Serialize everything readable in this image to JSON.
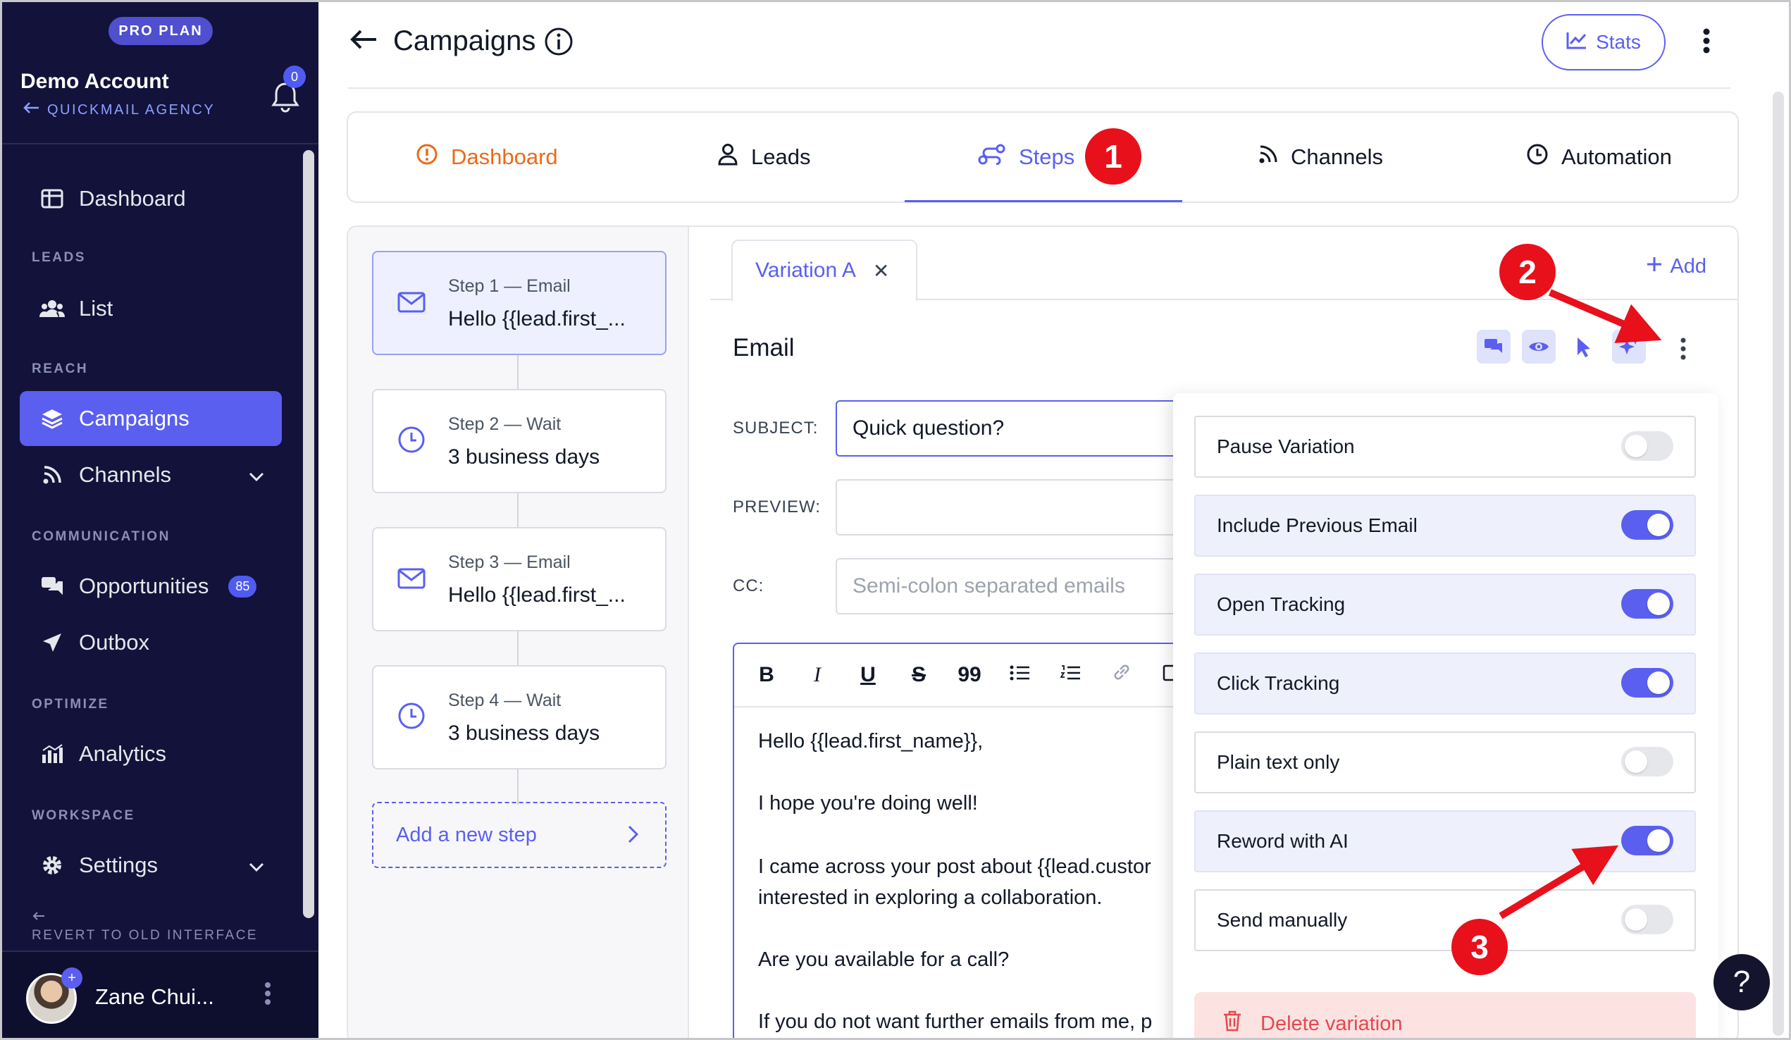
{
  "sidebar": {
    "plan_badge": "PRO PLAN",
    "account_name": "Demo Account",
    "agency_link": "QUICKMAIL AGENCY",
    "notification_count": "0",
    "items": {
      "dashboard": "Dashboard",
      "leads_section": "LEADS",
      "list": "List",
      "reach_section": "REACH",
      "campaigns": "Campaigns",
      "channels": "Channels",
      "communication_section": "COMMUNICATION",
      "opportunities": "Opportunities",
      "opportunities_count": "85",
      "outbox": "Outbox",
      "optimize_section": "OPTIMIZE",
      "analytics": "Analytics",
      "workspace_section": "WORKSPACE",
      "settings": "Settings"
    },
    "revert_label": "REVERT TO OLD INTERFACE",
    "user_name": "Zane Chui..."
  },
  "header": {
    "title": "Campaigns",
    "stats_button": "Stats"
  },
  "tabs": {
    "dashboard": "Dashboard",
    "leads": "Leads",
    "steps": "Steps",
    "channels": "Channels",
    "automation": "Automation"
  },
  "markers": [
    "1",
    "2",
    "3"
  ],
  "steps": [
    {
      "title": "Step 1 — Email",
      "body": "Hello {{lead.first_..."
    },
    {
      "title": "Step 2 — Wait",
      "body": "3 business days"
    },
    {
      "title": "Step 3 — Email",
      "body": "Hello {{lead.first_..."
    },
    {
      "title": "Step 4 — Wait",
      "body": "3 business days"
    }
  ],
  "add_step": "Add a new step",
  "variation": {
    "tab_label": "Variation A",
    "add_label": "Add",
    "section_title": "Email"
  },
  "fields": {
    "subject_label": "SUBJECT:",
    "subject_value": "Quick question?",
    "preview_label": "PREVIEW:",
    "preview_value": "",
    "cc_label": "CC:",
    "cc_placeholder": "Semi-colon separated emails"
  },
  "editor": {
    "toolbar": [
      "B",
      "I",
      "U",
      "S",
      "99"
    ],
    "lines": [
      "Hello {{lead.first_name}},",
      "I hope you're doing well!",
      "I came across your post about {{lead.custor",
      "interested in exploring a collaboration.",
      "Are you available for a call?",
      "If you do not want further emails from me, p"
    ]
  },
  "options": [
    {
      "label": "Pause Variation",
      "enabled": false
    },
    {
      "label": "Include Previous Email",
      "enabled": true
    },
    {
      "label": "Open Tracking",
      "enabled": true
    },
    {
      "label": "Click Tracking",
      "enabled": true
    },
    {
      "label": "Plain text only",
      "enabled": false
    },
    {
      "label": "Reword with AI",
      "enabled": true
    },
    {
      "label": "Send manually",
      "enabled": false
    }
  ],
  "delete_label": "Delete variation",
  "help_label": "?",
  "colors": {
    "accent": "#5a5ff0",
    "sidebar": "#12123a",
    "marker": "#e8101a",
    "orange": "#ea6a1a",
    "danger": "#e5484d"
  }
}
